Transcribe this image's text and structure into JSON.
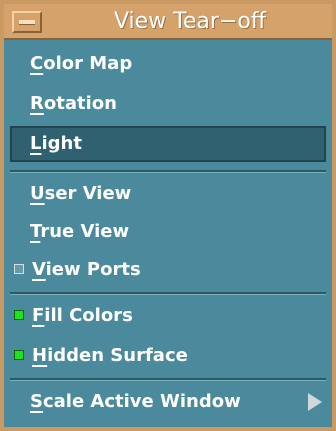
{
  "window": {
    "title": "View Tear−off"
  },
  "menu": {
    "color_map": "Color Map",
    "rotation": "Rotation",
    "light": "Light",
    "user_view": "User View",
    "true_view": "True View",
    "view_ports": "View Ports",
    "fill_colors": "Fill Colors",
    "hidden_surface": "Hidden Surface",
    "scale_active_window": "Scale Active Window"
  },
  "state": {
    "selected_item": "Light",
    "view_ports_checked": false,
    "fill_colors_checked": true,
    "hidden_surface_checked": true
  },
  "colors": {
    "titlebar": "#d5a26c",
    "menu_bg": "#4a8a9c",
    "selected_bg": "#2f6171",
    "indicator_on": "#1de31d"
  },
  "icons": {
    "window_menu": "window-menu-icon",
    "submenu": "submenu-arrow-icon"
  }
}
